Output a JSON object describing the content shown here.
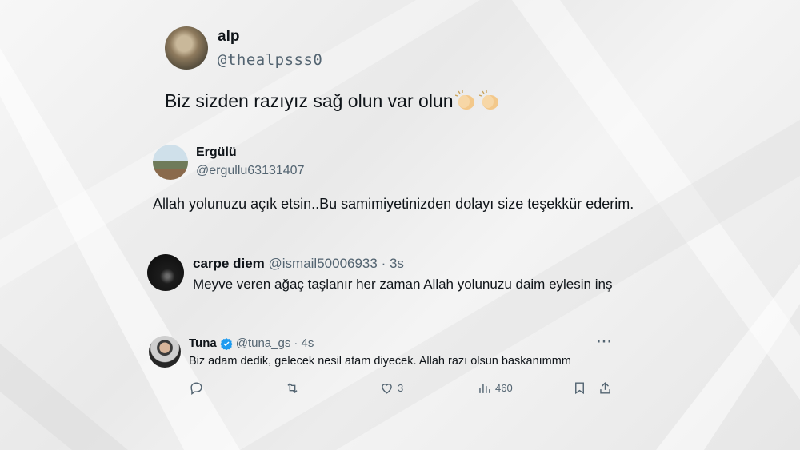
{
  "tweets": [
    {
      "name": "alp",
      "handle": "@thealpsss0",
      "text": "Biz sizden razıyız  sağ olun var olun"
    },
    {
      "name": "Ergülü",
      "handle": "@ergullu63131407",
      "text": "Allah yolunuzu açık etsin..Bu samimiyetinizden dolayı size teşekkür ederim."
    },
    {
      "name": "carpe diem",
      "handle": "@ismail50006933",
      "time": "· 3s",
      "text": "Meyve veren ağaç taşlanır her zaman Allah yolunuzu daim eylesin inş"
    },
    {
      "name": "Tuna",
      "handle": "@tuna_gs",
      "time": "· 4s",
      "text": "Biz adam dedik, gelecek nesil atam diyecek. Allah razı olsun baskanımmm",
      "more": "···",
      "likes": "3",
      "views": "460"
    }
  ],
  "icons": {
    "clap": "clapping-hands-icon",
    "verified": "verified-badge-icon",
    "reply": "reply-icon",
    "retweet": "retweet-icon",
    "like": "heart-icon",
    "views": "views-icon",
    "bookmark": "bookmark-icon",
    "share": "share-icon"
  },
  "colors": {
    "verified": "#1d9bf0",
    "muted": "#536471",
    "text": "#0f1419"
  }
}
